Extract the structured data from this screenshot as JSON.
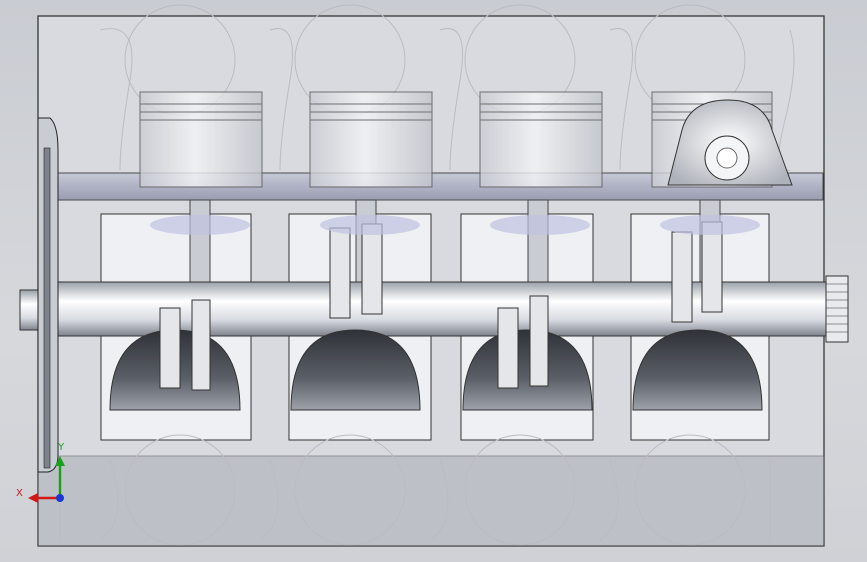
{
  "viewport": {
    "background_top": "#c9ccd2",
    "background_bottom": "#d6d8dc"
  },
  "model": {
    "block_color": "#d8dadf",
    "edge_color": "#2a2a2a",
    "metal_color": "#eceef2",
    "shadow_color": "#5a5f66",
    "wire_color": "#b9bcc2"
  },
  "triad": {
    "x_label": "X",
    "y_label": "Y",
    "x_color": "#d01818",
    "y_color": "#18a018",
    "z_color": "#1838d0"
  }
}
